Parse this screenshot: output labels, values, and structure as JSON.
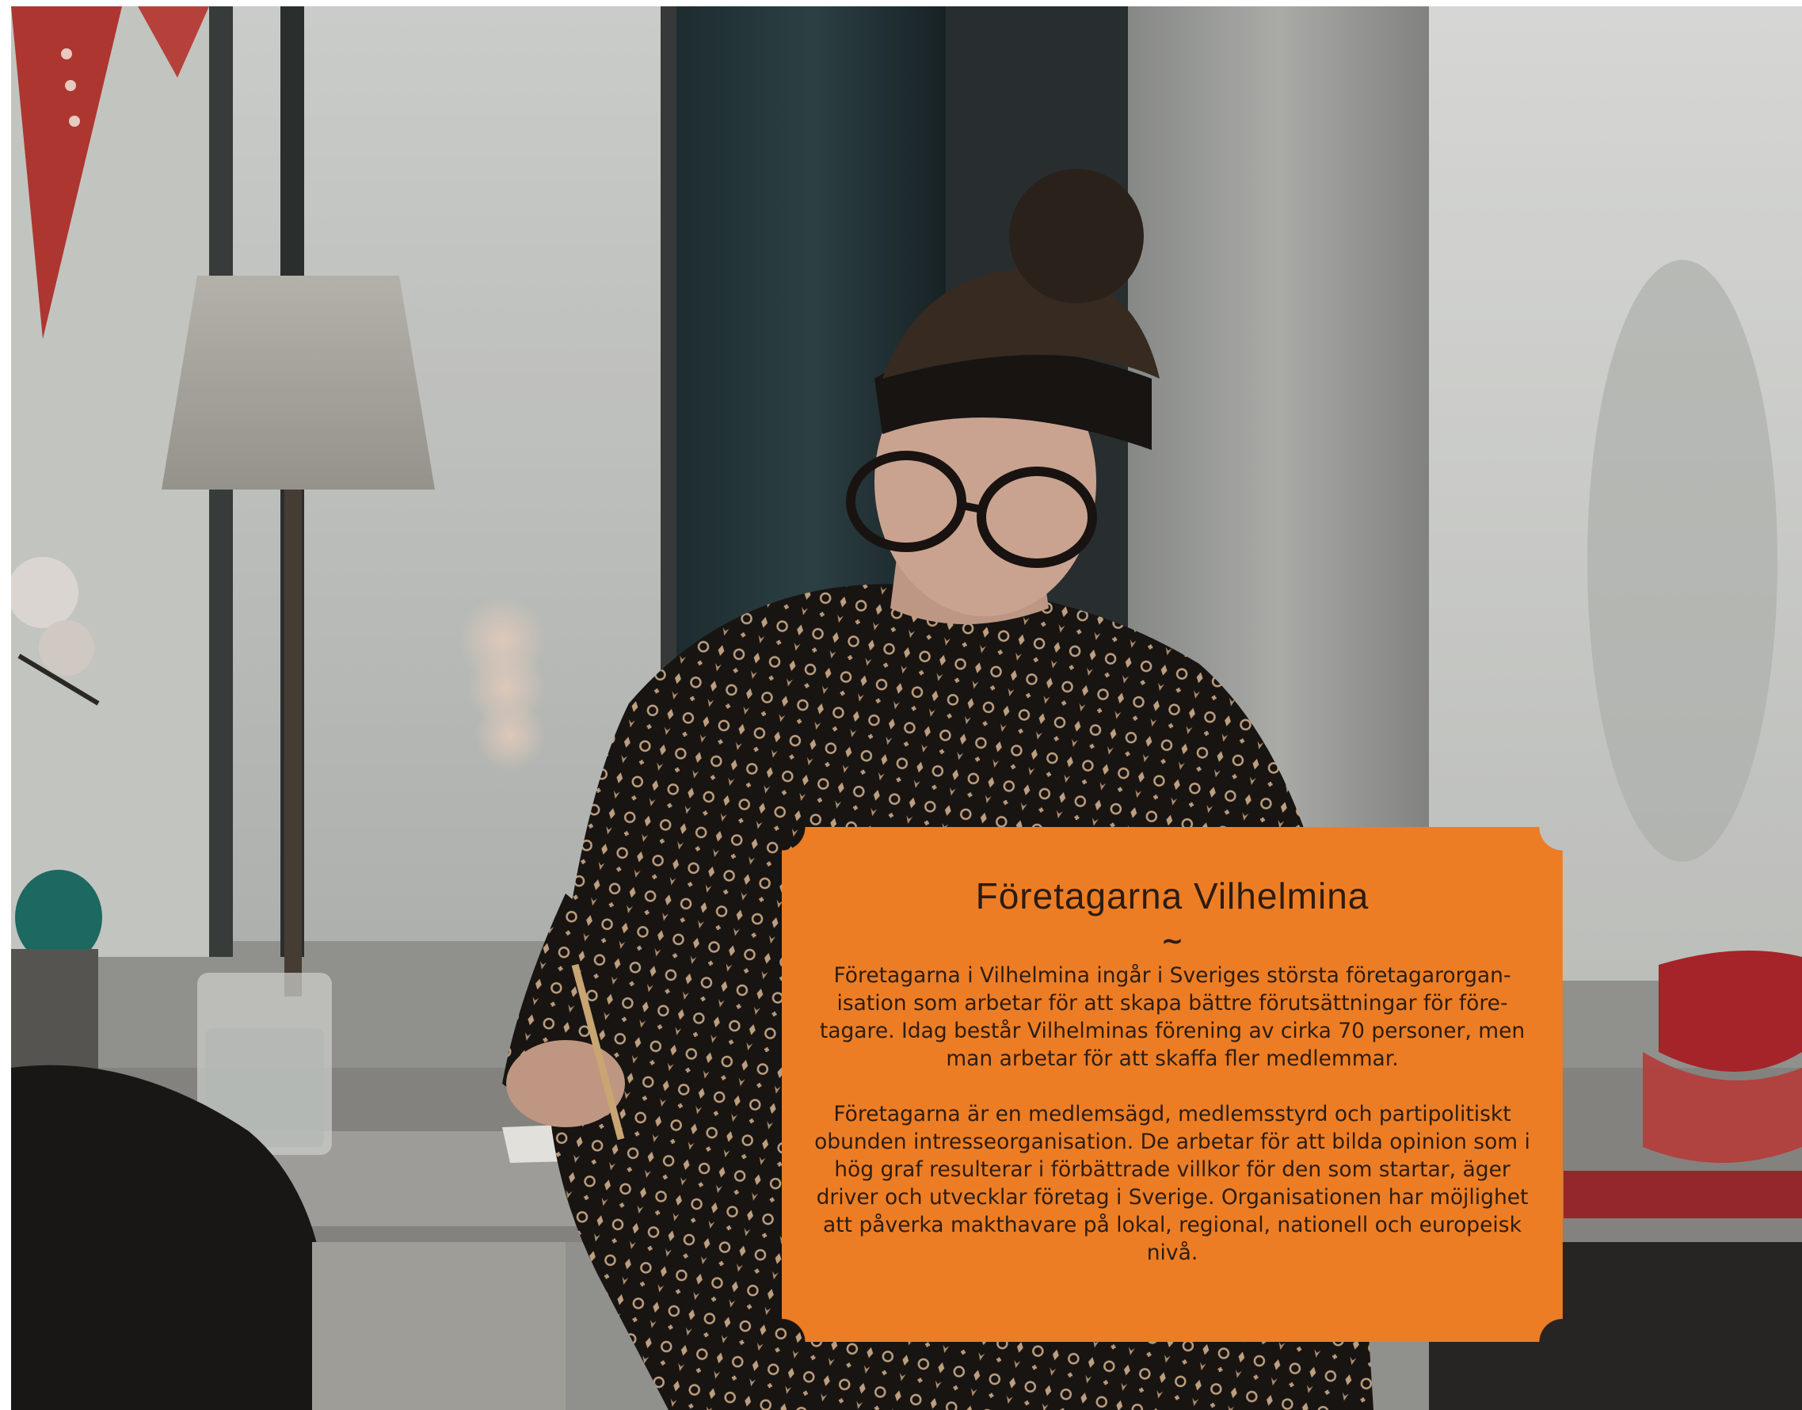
{
  "card": {
    "title": "Företagarna Vilhelmina",
    "divider": "~",
    "paragraphs": [
      "Företagarna i Vilhelmina ingår i Sveriges största företagarorgan­isation som arbetar för att skapa bättre förutsättningar för före­tagare. Idag består Vilhelminas förening av cirka 70 personer, men man arbetar för att skaffa fler medlemmar.",
      "Företagarna är en medlemsägd, medlemsstyrd och partipolitiskt obunden intresseorganisation. De arbetar för att bilda opinion som i hög graf resulterar i förbättrade villkor för den som startar, äger driver och utvecklar företag i Sverige. Organisationen har möjlighet att påverka makthavare på lokal, regional, nationell och europeisk nivå."
    ]
  },
  "colors": {
    "card_background": "#ed7d24",
    "card_text": "#2b1c12"
  }
}
